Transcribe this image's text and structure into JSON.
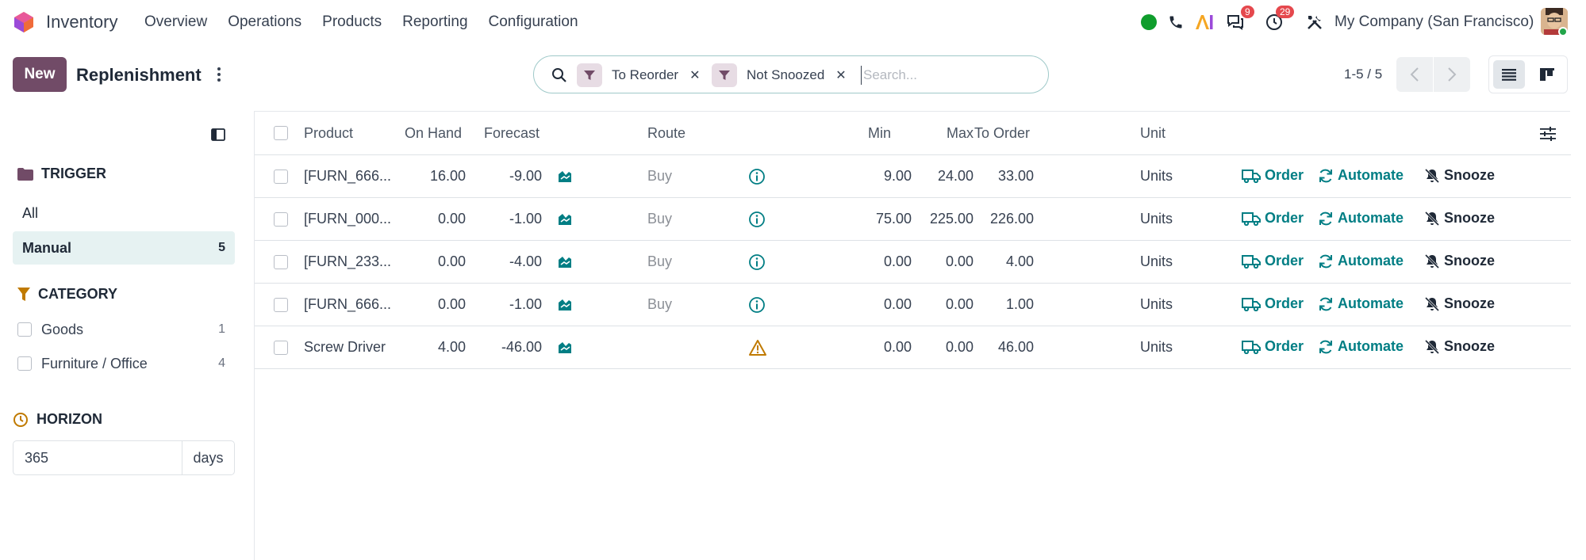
{
  "nav": {
    "app_name": "Inventory",
    "menu": [
      "Overview",
      "Operations",
      "Products",
      "Reporting",
      "Configuration"
    ],
    "chat_badge": "9",
    "activity_badge": "29",
    "company": "My Company (San Francisco)",
    "status_color": "#0f9d2c",
    "brand_color": "#714b67"
  },
  "control": {
    "new_label": "New",
    "title": "Replenishment",
    "facets": [
      "To Reorder",
      "Not Snoozed"
    ],
    "search_placeholder": "Search...",
    "pager": "1-5 / 5"
  },
  "sidebar": {
    "trigger": {
      "heading": "TRIGGER",
      "items": [
        {
          "label": "All",
          "count": ""
        },
        {
          "label": "Manual",
          "count": "5"
        }
      ]
    },
    "category": {
      "heading": "CATEGORY",
      "items": [
        {
          "label": "Goods",
          "count": "1"
        },
        {
          "label": "Furniture / Office",
          "count": "4"
        }
      ]
    },
    "horizon": {
      "heading": "HORIZON",
      "value": "365",
      "unit": "days"
    }
  },
  "table": {
    "columns": {
      "product": "Product",
      "on_hand": "On Hand",
      "forecast": "Forecast",
      "route": "Route",
      "min": "Min",
      "max": "Max",
      "to_order": "To Order",
      "unit": "Unit"
    },
    "actions": {
      "order": "Order",
      "automate": "Automate",
      "snooze": "Snooze"
    },
    "rows": [
      {
        "product": "[FURN_666...",
        "on_hand": "16.00",
        "forecast": "-9.00",
        "route": "Buy",
        "status": "info",
        "min": "9.00",
        "max": "24.00",
        "to_order": "33.00",
        "unit": "Units"
      },
      {
        "product": "[FURN_000...",
        "on_hand": "0.00",
        "forecast": "-1.00",
        "route": "Buy",
        "status": "info",
        "min": "75.00",
        "max": "225.00",
        "to_order": "226.00",
        "unit": "Units"
      },
      {
        "product": "[FURN_233...",
        "on_hand": "0.00",
        "forecast": "-4.00",
        "route": "Buy",
        "status": "info",
        "min": "0.00",
        "max": "0.00",
        "to_order": "4.00",
        "unit": "Units"
      },
      {
        "product": "[FURN_666...",
        "on_hand": "0.00",
        "forecast": "-1.00",
        "route": "Buy",
        "status": "info",
        "min": "0.00",
        "max": "0.00",
        "to_order": "1.00",
        "unit": "Units"
      },
      {
        "product": "Screw Driver",
        "on_hand": "4.00",
        "forecast": "-46.00",
        "route": "",
        "status": "warning",
        "min": "0.00",
        "max": "0.00",
        "to_order": "46.00",
        "unit": "Units"
      }
    ]
  }
}
